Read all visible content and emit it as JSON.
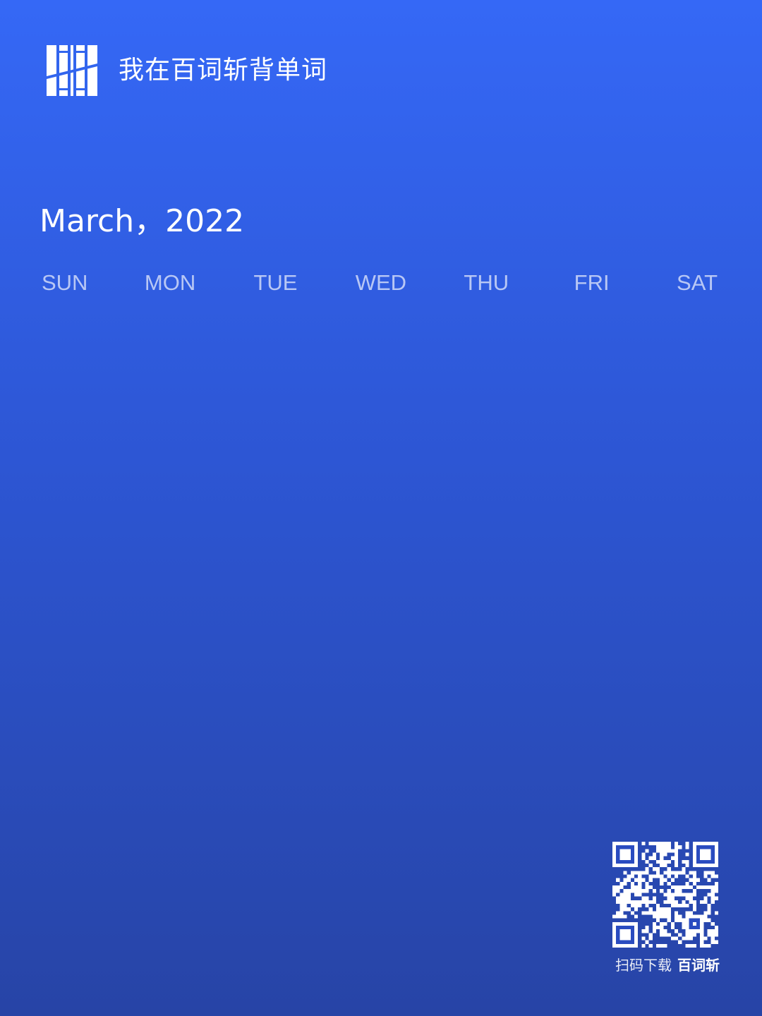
{
  "header": {
    "logo_icon": "baicizhan-100-logo-icon",
    "title": "我在百词斩背单词"
  },
  "calendar": {
    "month_title": "March，2022",
    "weekdays": [
      "SUN",
      "MON",
      "TUE",
      "WED",
      "THU",
      "FRI",
      "SAT"
    ]
  },
  "footer": {
    "qr_icon": "qr-code-icon",
    "caption_prefix": "扫码下载",
    "caption_brand": "百词斩"
  },
  "colors": {
    "background_top": "#3568f6",
    "background_bottom": "#2744a6",
    "text": "#ffffff"
  }
}
